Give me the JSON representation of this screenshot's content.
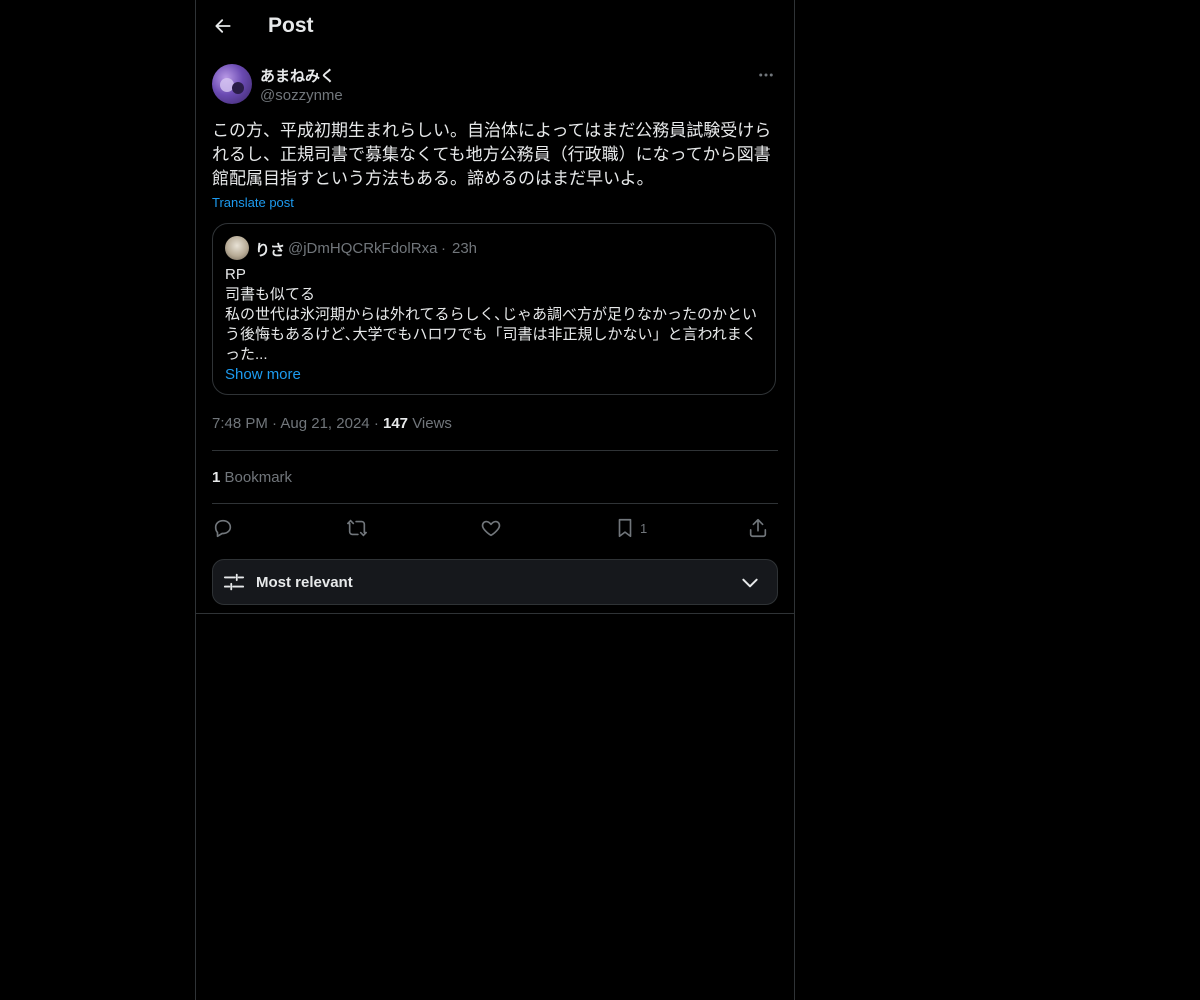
{
  "header": {
    "title": "Post"
  },
  "post": {
    "display_name": "あまねみく",
    "handle": "@sozzynme",
    "text": "この方、平成初期生まれらしい。自治体によってはまだ公務員試験受けられるし、正規司書で募集なくても地方公務員（行政職）になってから図書館配属目指すという方法もある。諦めるのはまだ早いよ。",
    "translate_label": "Translate post",
    "time": "7:48 PM",
    "date": "Aug 21, 2024",
    "views_count": "147",
    "views_label": "Views",
    "bookmark_count": "1",
    "bookmark_label": "Bookmark"
  },
  "quote": {
    "display_name": "りさ",
    "handle": "@jDmHQCRkFdolRxa",
    "separator": "·",
    "time": "23h",
    "text": "RP\n司書も似てる\n私の世代は氷河期からは外れてるらしく､じゃあ調べ方が足りなかったのかという後悔もあるけど､大学でもハロワでも「司書は非正規しかない」と言われまくった...",
    "show_more": "Show more"
  },
  "actions": {
    "reply_icon": "reply-icon",
    "repost_icon": "repost-icon",
    "like_icon": "heart-icon",
    "bookmark_icon": "bookmark-icon",
    "bookmark_count": "1",
    "share_icon": "share-icon"
  },
  "sort": {
    "label": "Most relevant",
    "icon": "sliders-icon"
  },
  "colors": {
    "background": "#000000",
    "text": "#e7e9ea",
    "muted": "#71767b",
    "accent": "#1d9bf0",
    "border": "#2f3336"
  }
}
